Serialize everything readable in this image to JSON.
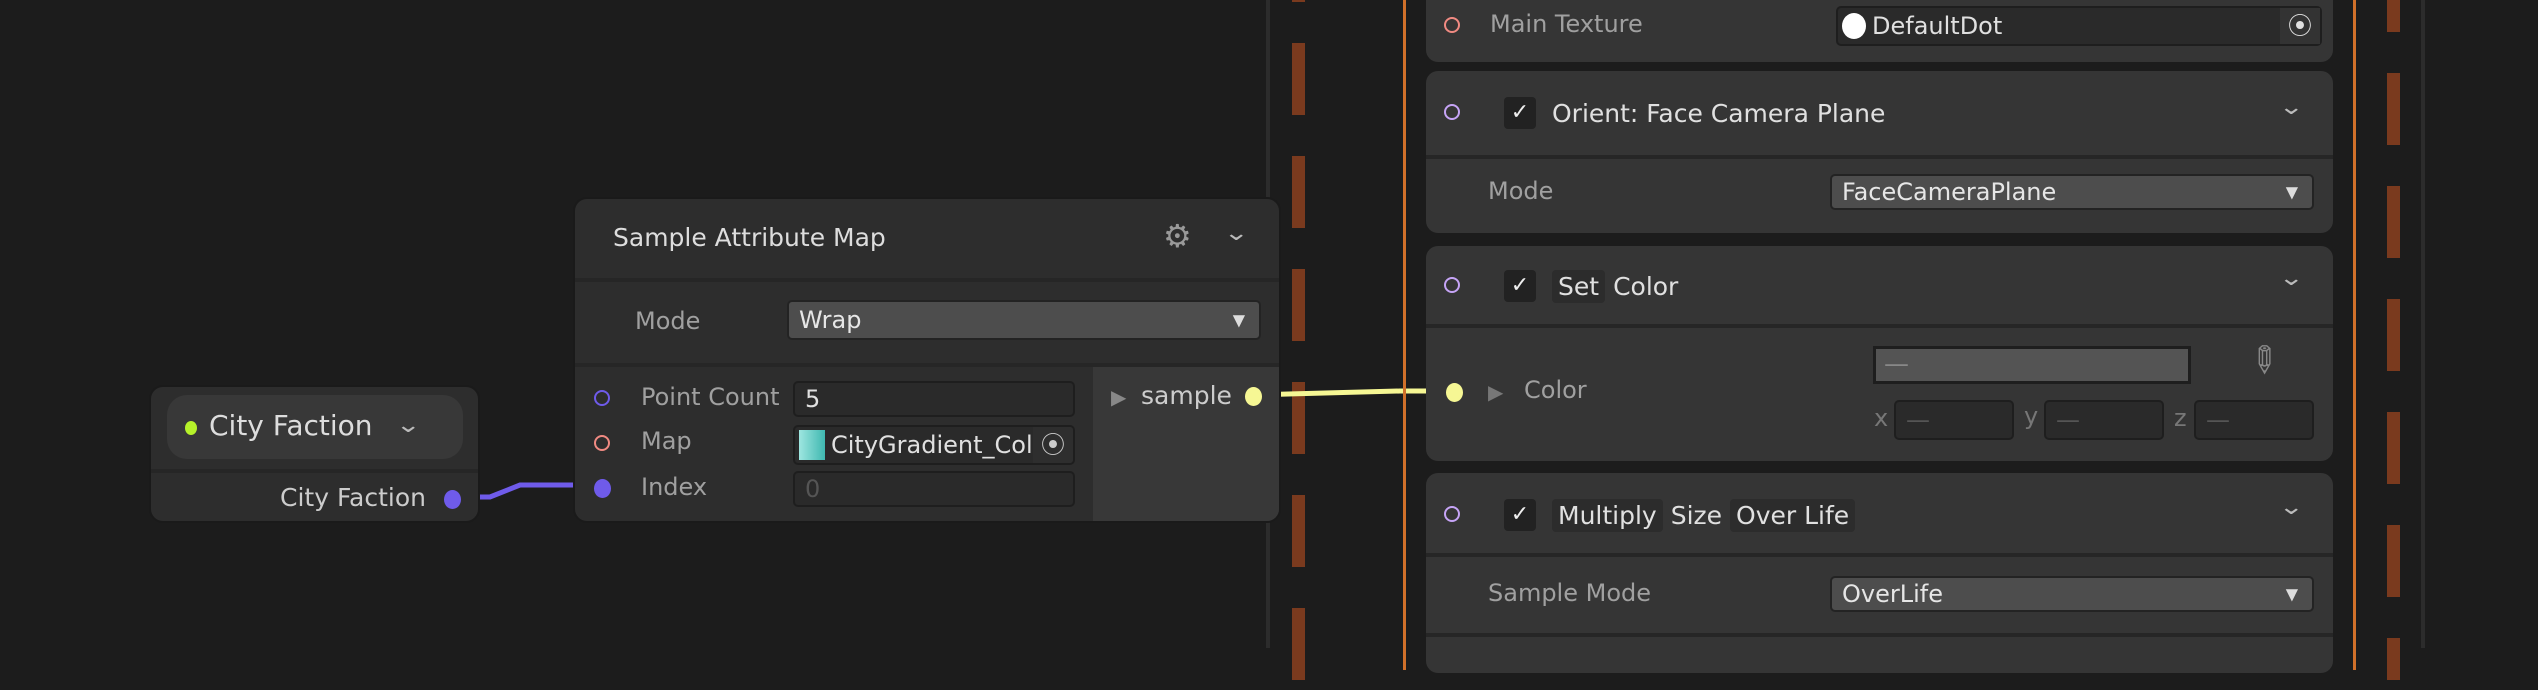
{
  "city_faction_node": {
    "title": "City Faction",
    "output_label": "City Faction"
  },
  "sample_attribute_map": {
    "title": "Sample Attribute Map",
    "mode_label": "Mode",
    "mode_value": "Wrap",
    "point_count_label": "Point Count",
    "point_count_value": "5",
    "map_label": "Map",
    "map_value": "CityGradient_Col",
    "index_label": "Index",
    "index_placeholder": "0",
    "output_label": "sample"
  },
  "context": {
    "main_texture": {
      "label": "Main Texture",
      "value": "DefaultDot"
    },
    "orient": {
      "title": "Orient: Face Camera Plane",
      "mode_label": "Mode",
      "mode_value": "FaceCameraPlane",
      "enabled": true
    },
    "set_color": {
      "title_1": "Set",
      "title_2": "Color",
      "color_label": "Color",
      "color_value": "—",
      "x_label": "x",
      "y_label": "y",
      "z_label": "z",
      "x_value": "—",
      "y_value": "—",
      "z_value": "—",
      "enabled": true
    },
    "multiply_size": {
      "title_1": "Multiply",
      "title_2": "Size",
      "title_3": "Over Life",
      "sample_mode_label": "Sample Mode",
      "sample_mode_value": "OverLife",
      "enabled": true
    }
  },
  "colors": {
    "float_port": "#b6f22a",
    "int_port": "#6f5bea",
    "texture_port": "#f08a82",
    "vector_port": "#f6f794",
    "flow_port": "#c6a4f6",
    "context_border": "#d0702a"
  }
}
